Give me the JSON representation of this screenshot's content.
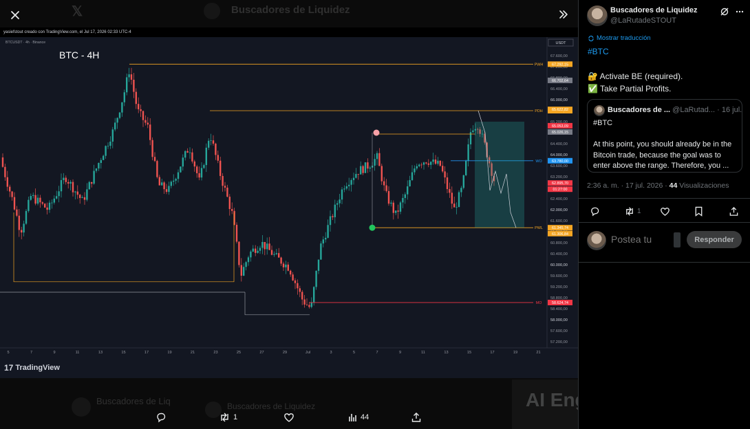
{
  "viewer": {
    "ghost": {
      "title": "Buscadores de Liquidez",
      "x_glyph": "𝕏",
      "card_1": "Buscadores de Liq",
      "card_2": "Buscadores de Liquidez",
      "banner": "AI Eng"
    },
    "tradingview": {
      "header": "yasiefstout creado con TradingView.com, el Jul 17, 2026 02:33 UTC-4",
      "symbol_line": "BTCUSDT · 4h · Binance",
      "chart_title": "BTC - 4H",
      "currency": "USDT",
      "brand": "TradingView",
      "brand_mark": "17",
      "price_axis": [
        "67.600,00",
        "67.200,00",
        "66.800,00",
        "66.400,00",
        "66.000,00",
        "65.600,00",
        "65.200,00",
        "64.800,00",
        "64.400,00",
        "64.000,00",
        "63.600,00",
        "63.200,00",
        "62.800,00",
        "62.400,00",
        "62.000,00",
        "61.600,00",
        "61.200,00",
        "60.800,00",
        "60.400,00",
        "60.000,00",
        "59.600,00",
        "59.200,00",
        "58.800,00",
        "58.400,00",
        "58.000,00",
        "57.600,00",
        "57.200,00"
      ],
      "time_axis": [
        "5",
        "7",
        "9",
        "11",
        "13",
        "15",
        "17",
        "19",
        "21",
        "23",
        "25",
        "27",
        "29",
        "Jul",
        "3",
        "5",
        "7",
        "9",
        "11",
        "13",
        "15",
        "17",
        "19",
        "21"
      ],
      "levels": [
        {
          "label": "PWH",
          "price": "67.292,15",
          "color": "#f5a623"
        },
        {
          "label": "PDH",
          "price": "65.600,00",
          "color": "#f5a623"
        },
        {
          "label": "WO",
          "price": "63.780,00",
          "color": "#2196f3"
        },
        {
          "label": "PWL",
          "price": "61.345,74",
          "color": "#f5a623"
        },
        {
          "label": "MO",
          "price": "58.624,74",
          "color": "#f23645"
        }
      ],
      "axis_tags": [
        {
          "price": "66.702,64",
          "color": "#787b86"
        },
        {
          "price": "65.622,82",
          "color": "#f5a623"
        },
        {
          "price": "65.053,09",
          "color": "#f23645"
        },
        {
          "price": "65.026,15",
          "color": "#787b86"
        },
        {
          "price": "62.895,70",
          "color": "#f23645"
        },
        {
          "price": "01:27:00",
          "color": "#f23645"
        },
        {
          "price": "61.306,84",
          "color": "#f5a623"
        }
      ]
    },
    "actions": {
      "reply_count": "",
      "retweet_count": "1",
      "views_count": "44"
    }
  },
  "panel": {
    "author_name": "Buscadores de Liquidez",
    "author_handle": "@LaRutadeSTOUT",
    "translate": "Mostrar traducción",
    "hashtag": "#BTC",
    "lines": [
      "🔐 Activate BE (required).",
      "✅ Take Partial Profits."
    ],
    "quote": {
      "name": "Buscadores de ...",
      "handle": "@LaRutad...",
      "date": "· 16 jul.",
      "lines": [
        "#BTC",
        "",
        "At this point, you should already be in the",
        "Bitcoin trade, because the goal was to",
        "enter above the range. Therefore, you ..."
      ]
    },
    "meta_time": "2:36 a. m. · 17 jul. 2026 · ",
    "views_number": "44",
    "views_label": " Visualizaciones",
    "retweet_count": "1",
    "reply_placeholder": "Postea tu",
    "reply_button": "Responder"
  }
}
